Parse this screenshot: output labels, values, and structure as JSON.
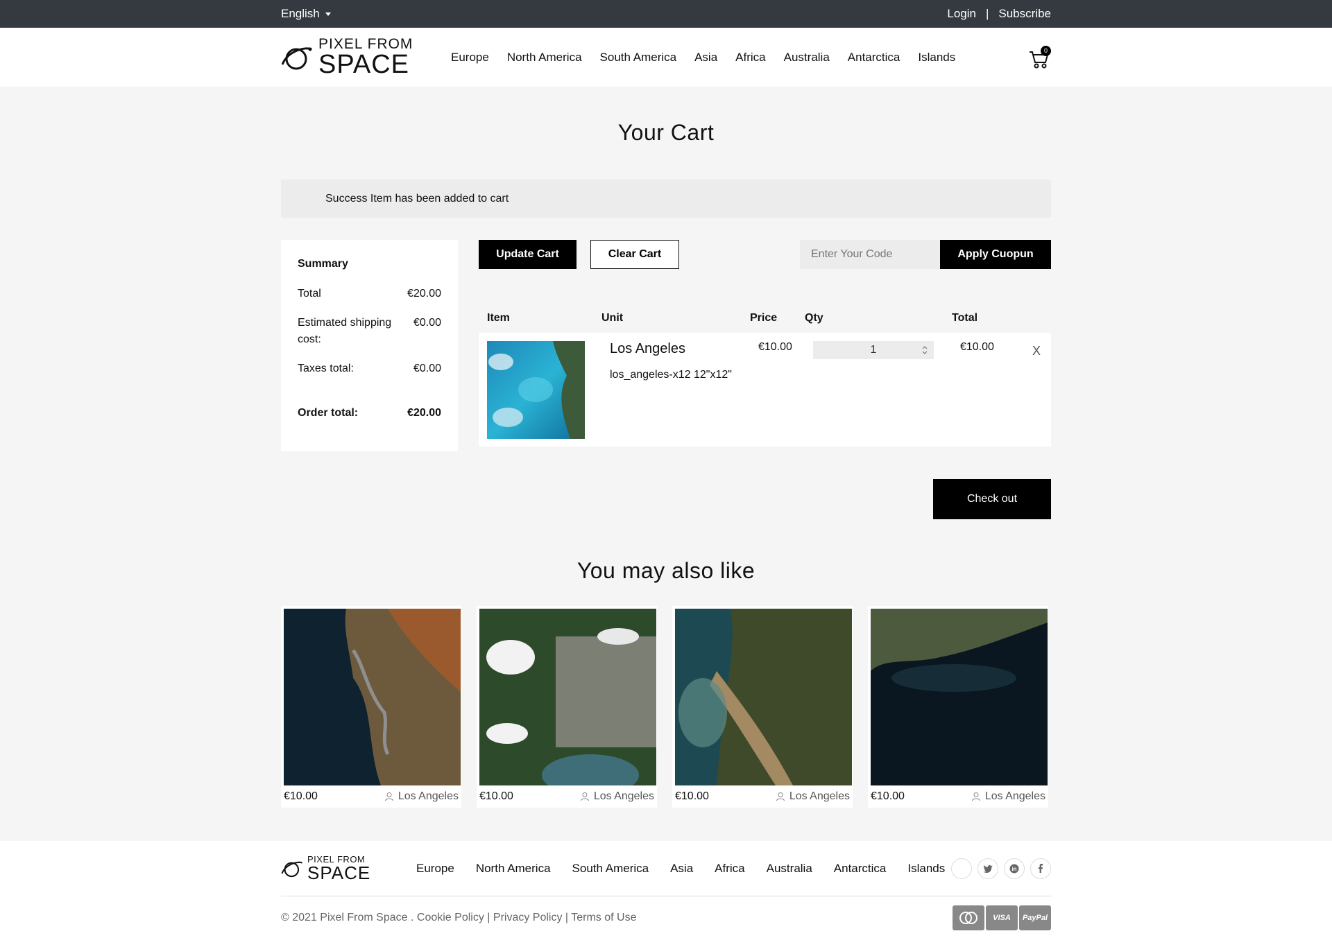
{
  "topbar": {
    "language": "English",
    "login": "Login",
    "separator": "|",
    "subscribe": "Subscribe"
  },
  "brand": {
    "line1": "PIXEL FROM",
    "line2": "SPACE"
  },
  "nav": [
    "Europe",
    "North America",
    "South America",
    "Asia",
    "Africa",
    "Australia",
    "Antarctica",
    "Islands"
  ],
  "cart_count": "0",
  "page_title": "Your Cart",
  "alert": "Success Item has been added to cart",
  "summary": {
    "heading": "Summary",
    "total_label": "Total",
    "total_value": "€20.00",
    "shipping_label": "Estimated shipping cost:",
    "shipping_value": "€0.00",
    "taxes_label": "Taxes total:",
    "taxes_value": "€0.00",
    "order_label": "Order total:",
    "order_value": "€20.00"
  },
  "actions": {
    "update": "Update Cart",
    "clear": "Clear Cart",
    "coupon_placeholder": "Enter Your Code",
    "apply": "Apply Cuopun"
  },
  "table": {
    "headers": {
      "item": "Item",
      "unit": "Unit",
      "price": "Price",
      "qty": "Qty",
      "total": "Total"
    },
    "row": {
      "name": "Los Angeles",
      "sku": "los_angeles-x12 12\"x12\"",
      "price": "€10.00",
      "qty": "1",
      "total": "€10.00",
      "remove": "X"
    }
  },
  "checkout": "Check out",
  "also_title": "You may also like",
  "products": [
    {
      "price": "€10.00",
      "location": "Los Angeles"
    },
    {
      "price": "€10.00",
      "location": "Los Angeles"
    },
    {
      "price": "€10.00",
      "location": "Los Angeles"
    },
    {
      "price": "€10.00",
      "location": "Los Angeles"
    }
  ],
  "footer": {
    "nav": [
      "Europe",
      "North America",
      "South America",
      "Asia",
      "Africa",
      "Australia",
      "Antarctica",
      "Islands"
    ],
    "copyright": "© 2021 Pixel From Space .",
    "cookie": "Cookie Policy",
    "privacy": "Privacy Policy",
    "terms": "Terms of Use",
    "sep": "|",
    "visa": "VISA",
    "paypal": "PayPal"
  },
  "colors": {
    "topbar": "#343a40",
    "accent": "#000000",
    "background": "#f5f5f5"
  }
}
